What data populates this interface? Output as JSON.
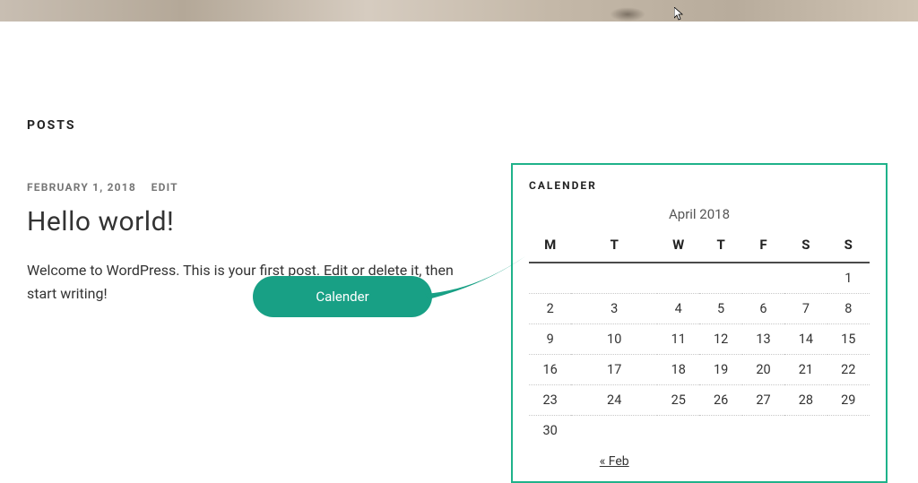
{
  "hero": {},
  "main": {
    "heading": "POSTS",
    "post": {
      "date": "FEBRUARY 1, 2018",
      "edit_label": "EDIT",
      "title": "Hello world!",
      "excerpt": "Welcome to WordPress. This is your first post. Edit or delete it, then start writing!"
    }
  },
  "sidebar": {
    "calendar": {
      "widget_title": "CALENDER",
      "caption": "April 2018",
      "weekdays": [
        "M",
        "T",
        "W",
        "T",
        "F",
        "S",
        "S"
      ],
      "rows": [
        [
          "",
          "",
          "",
          "",
          "",
          "",
          "1"
        ],
        [
          "2",
          "3",
          "4",
          "5",
          "6",
          "7",
          "8"
        ],
        [
          "9",
          "10",
          "11",
          "12",
          "13",
          "14",
          "15"
        ],
        [
          "16",
          "17",
          "18",
          "19",
          "20",
          "21",
          "22"
        ],
        [
          "23",
          "24",
          "25",
          "26",
          "27",
          "28",
          "29"
        ],
        [
          "30",
          "",
          "",
          "",
          "",
          "",
          ""
        ]
      ],
      "prev_label": "« Feb"
    }
  },
  "callout": {
    "label": "Calender"
  }
}
